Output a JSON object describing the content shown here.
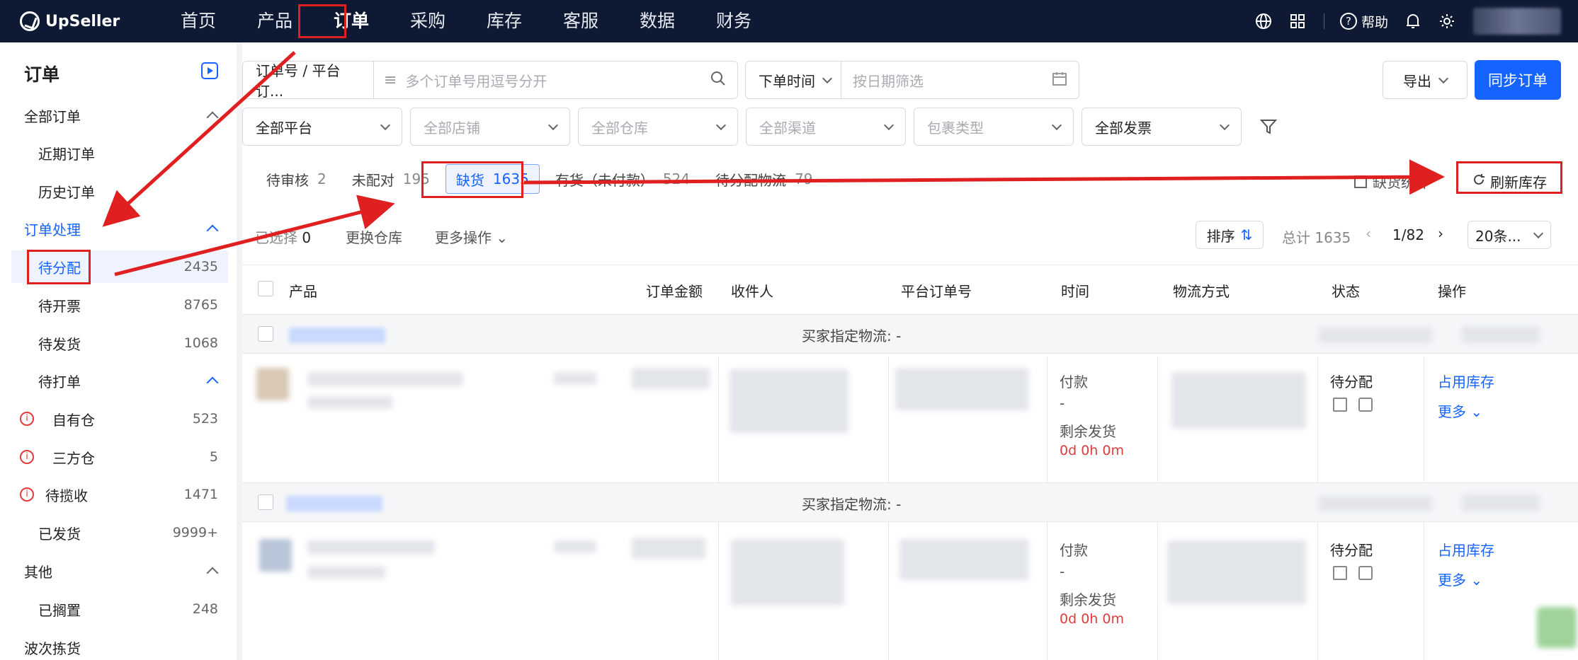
{
  "brand": "UpSeller",
  "nav": [
    "首页",
    "产品",
    "订单",
    "采购",
    "库存",
    "客服",
    "数据",
    "财务"
  ],
  "top_right": {
    "help": "帮助"
  },
  "sidebar": {
    "title": "订单",
    "groups": [
      {
        "label": "全部订单"
      },
      {
        "label": "近期订单"
      },
      {
        "label": "历史订单"
      },
      {
        "label": "订单处理"
      },
      {
        "label": "待分配",
        "count": "2435"
      },
      {
        "label": "待开票",
        "count": "8765"
      },
      {
        "label": "待发货",
        "count": "1068"
      },
      {
        "label": "待打单"
      },
      {
        "label": "自有仓",
        "count": "523"
      },
      {
        "label": "三方仓",
        "count": "5"
      },
      {
        "label": "待揽收",
        "count": "1471"
      },
      {
        "label": "已发货",
        "count": "9999+"
      },
      {
        "label": "其他"
      },
      {
        "label": "已搁置",
        "count": "248"
      },
      {
        "label": "波次拣货"
      }
    ]
  },
  "filters": {
    "order_type": "订单号 / 平台订...",
    "order_placeholder": "多个订单号用逗号分开",
    "time_type": "下单时间",
    "date_placeholder": "按日期筛选",
    "platform": "全部平台",
    "shop": "全部店铺",
    "warehouse": "全部仓库",
    "channel": "全部渠道",
    "package": "包裹类型",
    "invoice": "全部发票",
    "export": "导出",
    "sync": "同步订单"
  },
  "tabs": [
    {
      "label": "待审核",
      "count": "2"
    },
    {
      "label": "未配对",
      "count": "195"
    },
    {
      "label": "缺货",
      "count": "1635"
    },
    {
      "label": "有货（未付款）",
      "count": "524"
    },
    {
      "label": "待分配物流",
      "count": "79"
    }
  ],
  "tab_right": {
    "stats": "缺货统计",
    "refresh": "刷新库存"
  },
  "toolbar": {
    "selected": "已选择",
    "selected_count": "0",
    "change_wh": "更换仓库",
    "more_ops": "更多操作",
    "sort": "排序",
    "total": "总计 1635",
    "page": "1/82",
    "page_size": "20条..."
  },
  "columns": [
    "产品",
    "订单金额",
    "收件人",
    "平台订单号",
    "时间",
    "物流方式",
    "状态",
    "操作"
  ],
  "orders": [
    {
      "group_label": "买家指定物流: -",
      "time_label": "付款",
      "time_value": "-",
      "remain_label": "剩余发货",
      "remain_value": "0d 0h 0m",
      "status": "待分配",
      "action1": "占用库存",
      "action2": "更多"
    },
    {
      "group_label": "买家指定物流: -",
      "time_label": "付款",
      "time_value": "-",
      "remain_label": "剩余发货",
      "remain_value": "0d 0h 0m",
      "status": "待分配",
      "action1": "占用库存",
      "action2": "更多"
    }
  ]
}
